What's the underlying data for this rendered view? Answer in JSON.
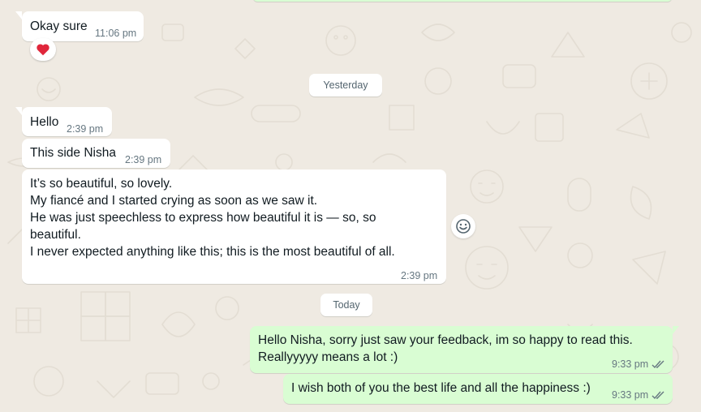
{
  "colors": {
    "background": "#efeae2",
    "incoming_bubble": "#ffffff",
    "outgoing_bubble": "#d9fdd3",
    "timestamp": "#667781",
    "read_ticks": "#667781",
    "heart": "#e0263b"
  },
  "messages_before": [
    {
      "direction": "incoming",
      "text": "Okay sure",
      "time": "11:06 pm",
      "reaction": "heart-icon"
    }
  ],
  "date_separators": {
    "yesterday": "Yesterday",
    "today": "Today"
  },
  "messages_yesterday": [
    {
      "direction": "incoming",
      "text": "Hello",
      "time": "2:39 pm"
    },
    {
      "direction": "incoming",
      "text": "This side Nisha",
      "time": "2:39 pm"
    },
    {
      "direction": "incoming",
      "lines": [
        "It’s so beautiful, so lovely.",
        "My fiancé and I started crying as soon as we saw it.",
        "He was just speechless to express how beautiful it is — so, so",
        "beautiful.",
        "I never expected anything like this; this is the most beautiful of all."
      ],
      "time": "2:39 pm"
    }
  ],
  "messages_today": [
    {
      "direction": "outgoing",
      "lines": [
        "Hello Nisha, sorry just saw your feedback, im so happy to read this.",
        "Reallyyyyy means a lot :)"
      ],
      "time": "9:33 pm",
      "status": "read-double-tick-icon"
    },
    {
      "direction": "outgoing",
      "text": "I wish both of you the best life and all the happiness :)",
      "time": "9:33 pm",
      "status": "read-double-tick-icon"
    }
  ],
  "actions": {
    "react_icon": "emoji-smiley-icon"
  }
}
